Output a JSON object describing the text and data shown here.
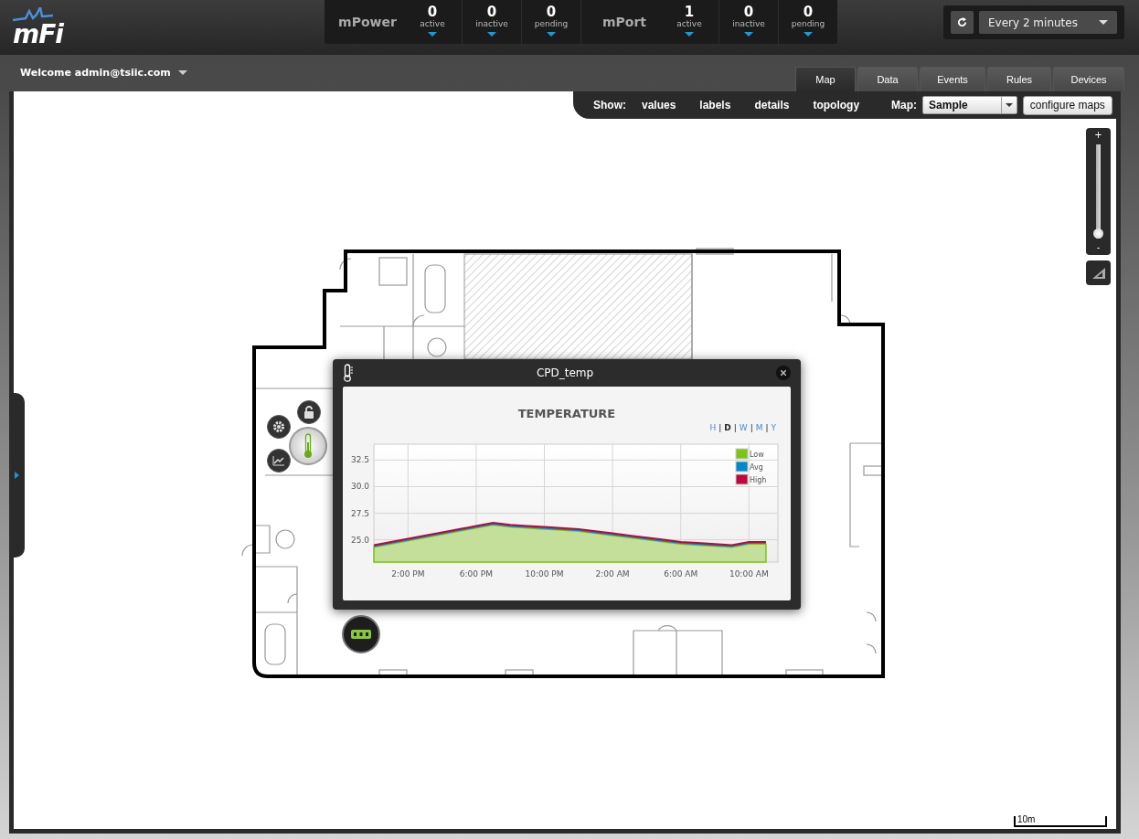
{
  "header": {
    "logo": "mFi",
    "groups": [
      {
        "name": "mPower",
        "stats": [
          {
            "value": "0",
            "label": "active"
          },
          {
            "value": "0",
            "label": "inactive"
          },
          {
            "value": "0",
            "label": "pending"
          }
        ]
      },
      {
        "name": "mPort",
        "stats": [
          {
            "value": "1",
            "label": "active"
          },
          {
            "value": "0",
            "label": "inactive"
          },
          {
            "value": "0",
            "label": "pending"
          }
        ]
      }
    ],
    "refresh": {
      "interval": "Every 2 minutes"
    }
  },
  "user_menu": {
    "label": "Welcome admin@tsiic.com"
  },
  "tabs": [
    {
      "label": "Map",
      "selected": true
    },
    {
      "label": "Data",
      "selected": false
    },
    {
      "label": "Events",
      "selected": false
    },
    {
      "label": "Rules",
      "selected": false
    },
    {
      "label": "Devices",
      "selected": false
    }
  ],
  "toolbar": {
    "show_label": "Show:",
    "show_options": [
      "values",
      "labels",
      "details",
      "topology"
    ],
    "map_label": "Map:",
    "map_select": "Sample",
    "configure_button": "configure maps"
  },
  "zoom_control": {
    "plus": "+",
    "minus": "-",
    "level": 0
  },
  "scale": "10m",
  "popup": {
    "title": "CPD_temp",
    "chart_title": "TEMPERATURE",
    "range_separator": "|",
    "ranges": [
      {
        "label": "H",
        "selected": false
      },
      {
        "label": "D",
        "selected": true
      },
      {
        "label": "W",
        "selected": false
      },
      {
        "label": "M",
        "selected": false
      },
      {
        "label": "Y",
        "selected": false
      }
    ],
    "chart_data": {
      "type": "area",
      "categories": [
        null,
        null,
        "2:00 PM",
        null,
        null,
        null,
        "6:00 PM",
        null,
        null,
        null,
        "10:00 PM",
        null,
        null,
        null,
        "2:00 AM",
        null,
        null,
        null,
        "6:00 AM",
        null,
        null,
        null,
        "10:00 AM",
        null
      ],
      "ylim": [
        22.9,
        34
      ],
      "grid": true,
      "legend": true,
      "yticks": [
        {
          "value": 25,
          "label": "25.0"
        },
        {
          "value": 27.5,
          "label": "27.5"
        },
        {
          "value": 30,
          "label": "30.0"
        },
        {
          "value": 32.5,
          "label": "32.5"
        }
      ],
      "series": [
        {
          "name": "Low",
          "type": "area",
          "color": "#7ec414",
          "values": [
            24.3,
            24.6,
            24.9,
            25.2,
            25.5,
            25.8,
            26.1,
            26.4,
            26.2,
            26.1,
            26.0,
            25.9,
            25.8,
            25.6,
            25.4,
            25.2,
            25.0,
            24.8,
            24.6,
            24.5,
            24.4,
            24.3,
            24.6,
            24.6
          ]
        },
        {
          "name": "Avg",
          "type": "line",
          "color": "#0088cc",
          "values": [
            24.4,
            24.7,
            25.0,
            25.3,
            25.6,
            25.9,
            26.2,
            26.5,
            26.3,
            26.2,
            26.1,
            26.0,
            25.9,
            25.7,
            25.5,
            25.3,
            25.1,
            24.9,
            24.7,
            24.6,
            24.5,
            24.4,
            24.7,
            24.7
          ]
        },
        {
          "name": "High",
          "type": "line",
          "color": "#c0063d",
          "values": [
            24.5,
            24.8,
            25.1,
            25.4,
            25.7,
            26.0,
            26.3,
            26.6,
            26.4,
            26.3,
            26.2,
            26.1,
            26.0,
            25.8,
            25.6,
            25.4,
            25.2,
            25.0,
            24.8,
            24.7,
            24.6,
            24.5,
            24.8,
            24.8
          ]
        }
      ]
    }
  }
}
